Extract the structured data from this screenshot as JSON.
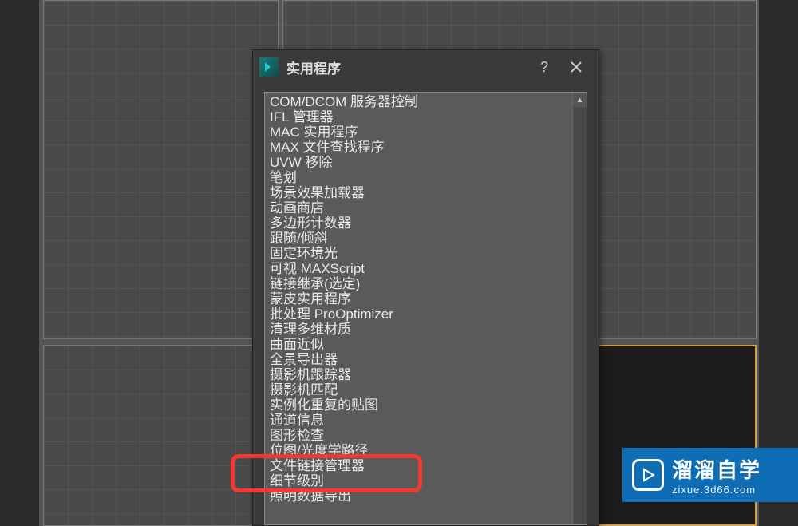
{
  "dialog": {
    "title": "实用程序",
    "items": [
      "COM/DCOM 服务器控制",
      "IFL 管理器",
      "MAC 实用程序",
      "MAX 文件查找程序",
      "UVW 移除",
      "笔划",
      "场景效果加载器",
      "动画商店",
      "多边形计数器",
      "跟随/倾斜",
      "固定环境光",
      "可视 MAXScript",
      "链接继承(选定)",
      "蒙皮实用程序",
      "批处理 ProOptimizer",
      "清理多维材质",
      "曲面近似",
      "全景导出器",
      "摄影机跟踪器",
      "摄影机匹配",
      "实例化重复的贴图",
      "通道信息",
      "图形检查",
      "位图/光度学路径",
      "文件链接管理器",
      "细节级别",
      "照明数据导出"
    ]
  },
  "watermark": {
    "main": "溜溜自学",
    "sub": "zixue.3d66.com"
  }
}
